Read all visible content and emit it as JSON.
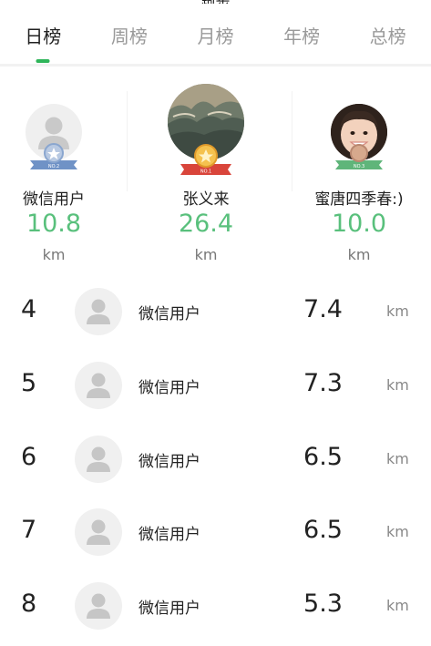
{
  "header": {
    "title": "跑步"
  },
  "tabs": [
    {
      "label": "日榜",
      "active": true
    },
    {
      "label": "周榜",
      "active": false
    },
    {
      "label": "月榜",
      "active": false
    },
    {
      "label": "年榜",
      "active": false
    },
    {
      "label": "总榜",
      "active": false
    }
  ],
  "podium": {
    "second": {
      "name": "微信用户",
      "value": "10.8",
      "unit": "km",
      "badge": "NO.2",
      "avatar": "default-user"
    },
    "first": {
      "name": "张义来",
      "value": "26.4",
      "unit": "km",
      "badge": "NO.1",
      "avatar": "landscape-painting"
    },
    "third": {
      "name": "蜜唐四季春:)",
      "value": "10.0",
      "unit": "km",
      "badge": "NO.3",
      "avatar": "child-photo"
    }
  },
  "ranking": [
    {
      "rank": "4",
      "name": "微信用户",
      "value": "7.4",
      "unit": "km"
    },
    {
      "rank": "5",
      "name": "微信用户",
      "value": "7.3",
      "unit": "km"
    },
    {
      "rank": "6",
      "name": "微信用户",
      "value": "6.5",
      "unit": "km"
    },
    {
      "rank": "7",
      "name": "微信用户",
      "value": "6.5",
      "unit": "km"
    },
    {
      "rank": "8",
      "name": "微信用户",
      "value": "5.3",
      "unit": "km"
    }
  ],
  "colors": {
    "accent": "#2fb55a",
    "value_green": "#59c07c",
    "medal_gold": "#f2b84b",
    "medal_silver": "#9fb6d6",
    "medal_bronze": "#8fcf9f"
  }
}
